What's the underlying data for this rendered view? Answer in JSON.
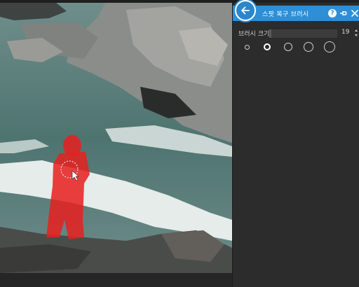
{
  "panel": {
    "title": "스팟 복구 브러시",
    "brush_size_label": "브러시 크기",
    "brush_size_value": "19",
    "brush_size_fraction": 0.03,
    "presets": [
      {
        "name": "preset-xsmall",
        "selected": false
      },
      {
        "name": "preset-small",
        "selected": true
      },
      {
        "name": "preset-medium",
        "selected": false
      },
      {
        "name": "preset-large",
        "selected": false
      },
      {
        "name": "preset-xlarge",
        "selected": false
      }
    ],
    "help_glyph": "?"
  },
  "colors": {
    "accent": "#2e8fd6",
    "mask": "#e8201e",
    "panel_bg": "#2c2c2c"
  },
  "icons": [
    "back-arrow-icon",
    "help-icon",
    "pin-icon",
    "close-icon",
    "stepper-icon"
  ]
}
